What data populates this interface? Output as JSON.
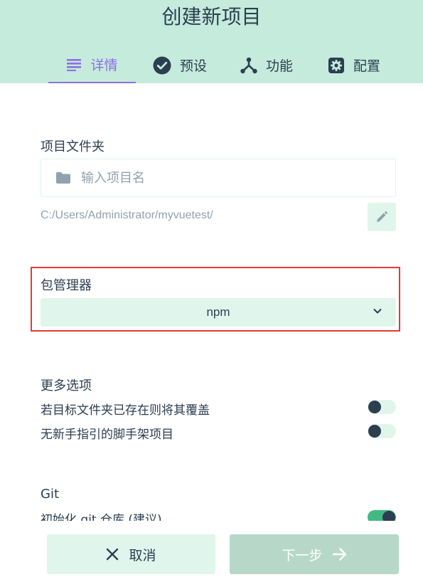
{
  "header": {
    "title": "创建新项目",
    "tabs": [
      {
        "label": "详情",
        "icon": "list-icon",
        "active": true
      },
      {
        "label": "预设",
        "icon": "check-circle-icon",
        "active": false
      },
      {
        "label": "功能",
        "icon": "fork-icon",
        "active": false
      },
      {
        "label": "配置",
        "icon": "gear-icon",
        "active": false
      }
    ]
  },
  "folder": {
    "label": "项目文件夹",
    "placeholder": "输入项目名",
    "path": "C:/Users/Administrator/myvuetest/"
  },
  "package_manager": {
    "label": "包管理器",
    "selected": "npm"
  },
  "more_options": {
    "label": "更多选项",
    "items": [
      {
        "label": "若目标文件夹已存在则将其覆盖",
        "enabled": false
      },
      {
        "label": "无新手指引的脚手架项目",
        "enabled": false
      }
    ]
  },
  "git": {
    "label": "Git",
    "init_label": "初始化 git 仓库 (建议)",
    "init_enabled": true
  },
  "footer": {
    "cancel_label": "取消",
    "next_label": "下一步"
  },
  "colors": {
    "header_bg": "#c4ebdc",
    "accent": "#8f6ee4",
    "text": "#2c3e50",
    "highlight_border": "#e1393d",
    "toggle_on": "#42b983",
    "button_bg": "#e0f6ec",
    "button_disabled": "#b7d8c9"
  }
}
